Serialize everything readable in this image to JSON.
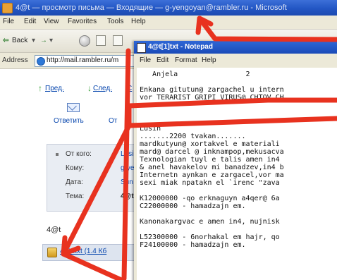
{
  "browser": {
    "title": "4@t — просмотр письма — Входящие — g-yengoyan@rambler.ru - Microsoft",
    "menu": [
      "File",
      "Edit",
      "View",
      "Favorites",
      "Tools",
      "Help"
    ],
    "toolbar": {
      "back_label": "Back"
    },
    "address": {
      "label": "Address",
      "url": "http://mail.rambler.ru/m"
    }
  },
  "mail": {
    "nav": {
      "prev": "Пред.",
      "next": "След.",
      "third": "С"
    },
    "reply_label": "Ответить",
    "reply_label_2": "От",
    "headers": [
      {
        "label": "От кого:",
        "value": "Lusi"
      },
      {
        "label": "Кому:",
        "value": "g-ye"
      },
      {
        "label": "Дата:",
        "value": "Sun"
      },
      {
        "label": "Тема:",
        "value": "4@t"
      }
    ],
    "subject_text": "4@t",
    "attachment": "4@t.txt (1.4 Кб"
  },
  "notepad": {
    "title": "4@t[1]txt - Notepad",
    "menu": [
      "File",
      "Edit",
      "Format",
      "Help"
    ],
    "lines": [
      "   Anjela                2",
      "",
      "Enkana gitutun@ zargachel u intern",
      "vor TERARIST GRIPI VIRUS@ CHTOV CH",
      "",
      "",
      "",
      "Lusin",
      ".......2200 tvakan.......",
      "mardkutyun@ xortakvel e materiali",
      "mard@ darcel @ inknampop,mekusacva",
      "Texnologian tuyl e talis amen in4",
      "& anel havakelov mi banadzev,in4 b",
      "Internetn aynkan e zargacel,vor ma",
      "sexi miak npatakn el `irenc \"zava",
      "",
      "K12000000 -qo erknaguyn a4qer@ 6a",
      "C22000000 - hamadzajn em.",
      "",
      "Kanonakargvac e amen in4, nujnisk",
      "",
      "L52300000 - 6norhakal em hajr, qo",
      "F24100000 - hamadzajn em."
    ]
  },
  "annotation": {
    "arrow_color": "#e8321f"
  }
}
